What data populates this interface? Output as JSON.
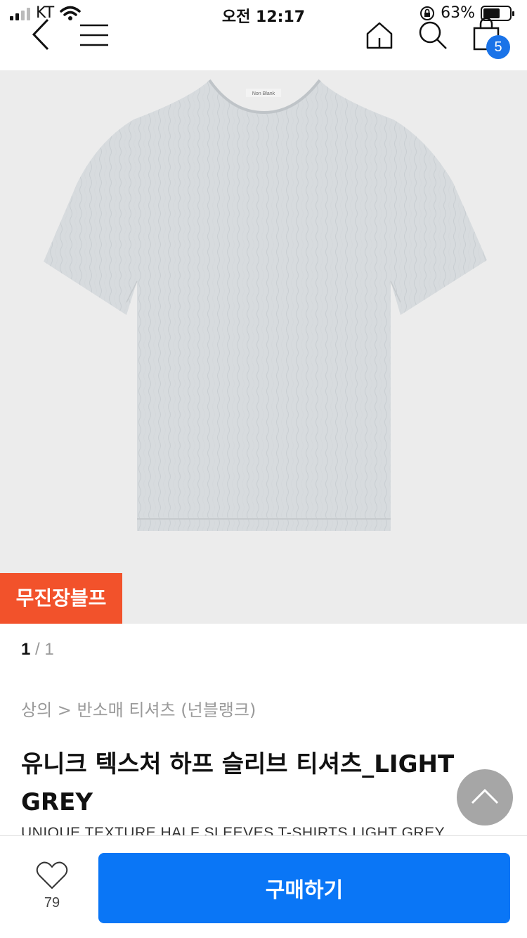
{
  "status_bar": {
    "carrier": "KT",
    "time": "오전 12:17",
    "battery_percent": "63%",
    "battery_level": 0.63
  },
  "nav": {
    "back_icon": "chevron-left-icon",
    "menu_icon": "hamburger-menu-icon",
    "home_icon": "home-icon",
    "search_icon": "search-icon",
    "cart_icon": "shopping-bag-icon",
    "cart_count": "5",
    "badge_color": "#1a73e8"
  },
  "product": {
    "store_tag": "무진장블프",
    "store_tag_color": "#f2522b",
    "image_label": "Non Blank",
    "pager_current": "1",
    "pager_sep": " / ",
    "pager_total": "1",
    "breadcrumb": "상의 > 반소매 티셔츠 (넌블랭크)",
    "title": "유니크 텍스처 하프 슬리브 티셔츠_LIGHT GREY",
    "subtitle": "UNIQUE TEXTURE HALF SLEEVES T-SHIRTS LIGHT GREY"
  },
  "bottom_bar": {
    "like_icon": "heart-icon",
    "like_count": "79",
    "buy_label": "구매하기",
    "buy_color": "#0a76f6"
  },
  "scroll_top_icon": "chevron-up-icon"
}
